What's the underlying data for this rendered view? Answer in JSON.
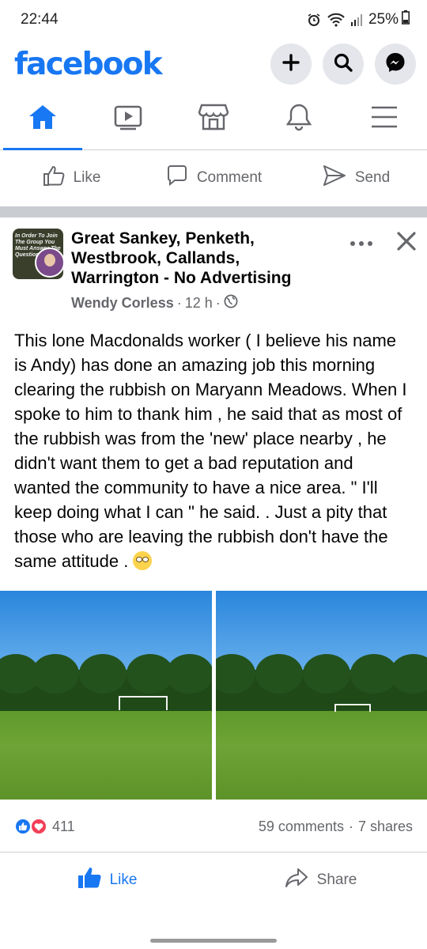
{
  "status_bar": {
    "time": "22:44",
    "battery": "25%"
  },
  "header": {
    "logo": "facebook",
    "buttons": [
      "add-icon",
      "search-icon",
      "messenger-icon"
    ]
  },
  "nav_tabs": [
    "home-icon",
    "watch-icon",
    "marketplace-icon",
    "notifications-icon",
    "menu-icon"
  ],
  "prev_post_actions": {
    "like": "Like",
    "comment": "Comment",
    "send": "Send"
  },
  "post": {
    "avatar_text": "In Order To Join The Group You Must Answer The Questions",
    "group_name": "Great Sankey, Penketh, Westbrook, Callands, Warrington - No Advertising",
    "author": "Wendy Corless",
    "time": "12 h",
    "body": "This lone Macdonalds worker ( I believe his name is Andy) has done an amazing job this morning clearing the rubbish on Maryann Meadows. When I spoke to him to thank him , he said that as most of the rubbish was from the 'new' place nearby , he didn't want them to get a bad reputation and wanted the community to have a nice area. \" I'll keep doing what I can \" he said. . Just a pity that those who are leaving the rubbish don't have the same attitude .",
    "reaction_count": "411",
    "comments": "59 comments",
    "shares": "7 shares",
    "actions": {
      "like": "Like",
      "share": "Share"
    }
  },
  "colors": {
    "brand": "#1877f2",
    "secondary_text": "#65676b",
    "divider": "#c9ccd1"
  }
}
